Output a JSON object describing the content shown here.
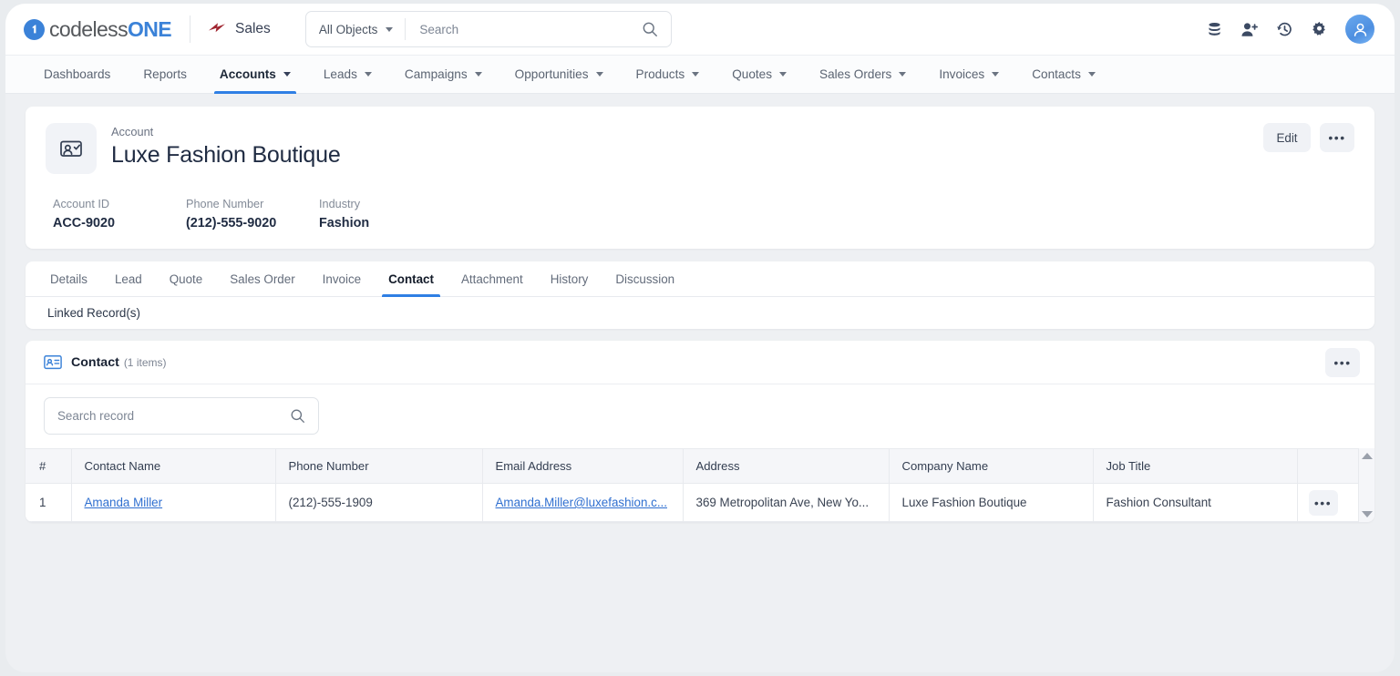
{
  "brand": {
    "logo_text_a": "codeless",
    "logo_text_b": "ONE",
    "app_name": "Sales",
    "accent": "#2f7fe4",
    "logo_blue": "#3b82d8",
    "sales_icon_color": "#a02530"
  },
  "search": {
    "scope_label": "All Objects",
    "placeholder": "Search",
    "value": ""
  },
  "topbar_icons": [
    {
      "name": "database-icon"
    },
    {
      "name": "add-user-icon"
    },
    {
      "name": "history-icon"
    },
    {
      "name": "gear-icon"
    },
    {
      "name": "avatar-icon"
    }
  ],
  "nav": {
    "items": [
      {
        "label": "Dashboards",
        "caret": false,
        "active": false
      },
      {
        "label": "Reports",
        "caret": false,
        "active": false
      },
      {
        "label": "Accounts",
        "caret": true,
        "active": true
      },
      {
        "label": "Leads",
        "caret": true,
        "active": false
      },
      {
        "label": "Campaigns",
        "caret": true,
        "active": false
      },
      {
        "label": "Opportunities",
        "caret": true,
        "active": false
      },
      {
        "label": "Products",
        "caret": true,
        "active": false
      },
      {
        "label": "Quotes",
        "caret": true,
        "active": false
      },
      {
        "label": "Sales Orders",
        "caret": true,
        "active": false
      },
      {
        "label": "Invoices",
        "caret": true,
        "active": false
      },
      {
        "label": "Contacts",
        "caret": true,
        "active": false
      }
    ]
  },
  "record": {
    "kicker": "Account",
    "title": "Luxe Fashion Boutique",
    "edit_label": "Edit",
    "more_label": "•••",
    "fields": [
      {
        "label": "Account ID",
        "value": "ACC-9020"
      },
      {
        "label": "Phone Number",
        "value": "(212)-555-9020"
      },
      {
        "label": "Industry",
        "value": "Fashion"
      }
    ]
  },
  "tabs": [
    {
      "label": "Details",
      "active": false
    },
    {
      "label": "Lead",
      "active": false
    },
    {
      "label": "Quote",
      "active": false
    },
    {
      "label": "Sales Order",
      "active": false
    },
    {
      "label": "Invoice",
      "active": false
    },
    {
      "label": "Contact",
      "active": true
    },
    {
      "label": "Attachment",
      "active": false
    },
    {
      "label": "History",
      "active": false
    },
    {
      "label": "Discussion",
      "active": false
    }
  ],
  "linked_records_label": "Linked Record(s)",
  "related_list": {
    "title": "Contact",
    "count_label": "(1 items)",
    "more_label": "•••",
    "search_placeholder": "Search record",
    "search_value": "",
    "columns": [
      "#",
      "Contact Name",
      "Phone Number",
      "Email Address",
      "Address",
      "Company Name",
      "Job Title"
    ],
    "rows": [
      {
        "index": "1",
        "contact_name": "Amanda Miller",
        "phone_number": "(212)-555-1909",
        "email_address": "Amanda.Miller@luxefashion.c...",
        "address": "369 Metropolitan Ave, New Yo...",
        "company_name": "Luxe Fashion Boutique",
        "job_title": "Fashion Consultant",
        "row_more_label": "•••"
      }
    ]
  }
}
